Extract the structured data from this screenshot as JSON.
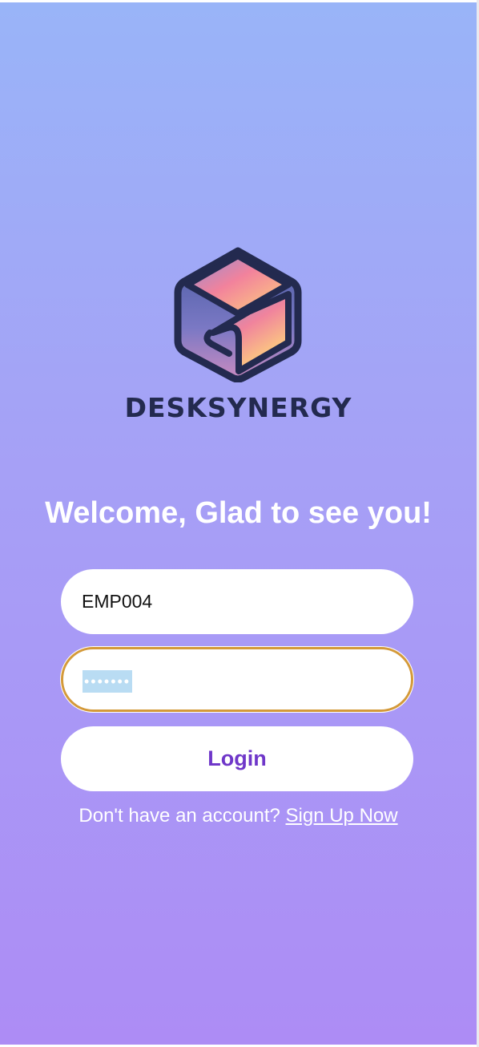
{
  "brand": {
    "name": "DESKSYNERGY",
    "logo_icon": "cube-logo-icon",
    "text_color": "#232a4f"
  },
  "welcome": {
    "title": "Welcome, Glad to see you!"
  },
  "form": {
    "username_value": "EMP004",
    "password_mask": "•••••••",
    "focus_color": "#d49a3a"
  },
  "login": {
    "label": "Login",
    "label_color": "#6f37c9"
  },
  "signup": {
    "prompt": "Don't have an account?",
    "link": "Sign Up Now"
  },
  "theme": {
    "gradient_top": "#99b4f8",
    "gradient_bottom": "#ad8cf5"
  }
}
